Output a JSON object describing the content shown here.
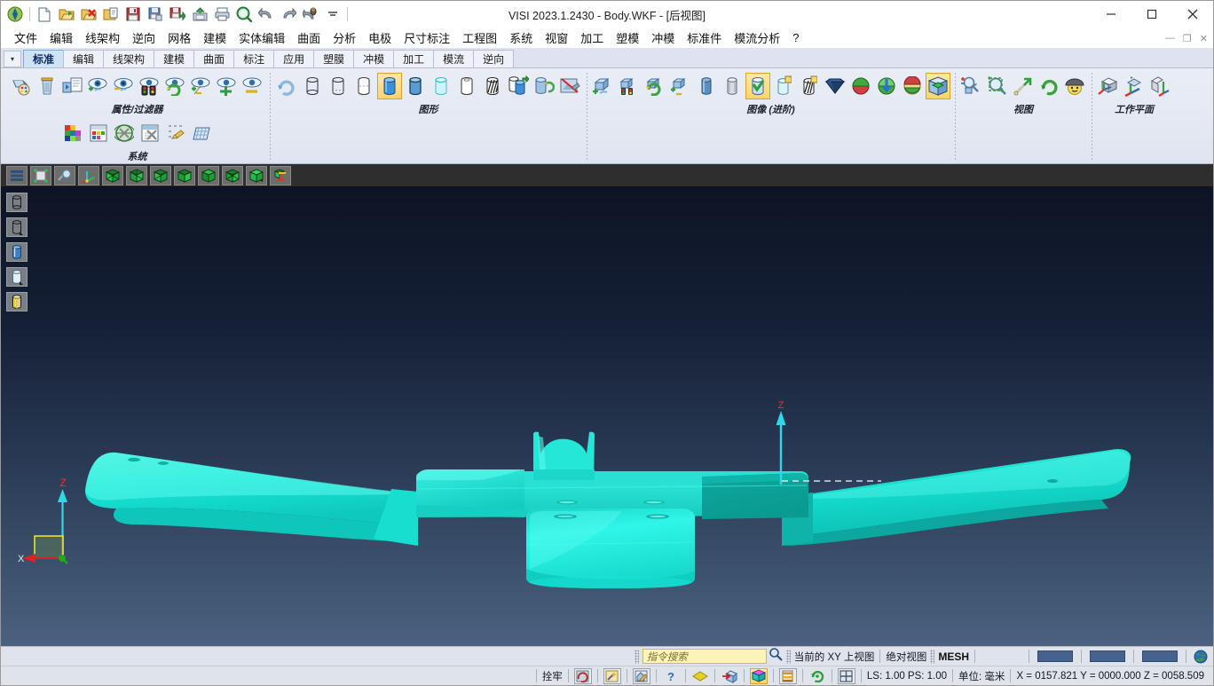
{
  "window": {
    "title": "VISI 2023.1.2430 - Body.WKF - [后视图]",
    "minimize": "—",
    "maximize": "☐",
    "close": "✕"
  },
  "mdi_controls": {
    "minimize": "—",
    "restore": "❐",
    "close": "✕"
  },
  "quick_access": [
    {
      "name": "app-logo-icon",
      "label": "VISI"
    },
    {
      "name": "new-file-icon",
      "label": "新建"
    },
    {
      "name": "open-file-icon",
      "label": "打开"
    },
    {
      "name": "close-file-icon",
      "label": "关闭"
    },
    {
      "name": "open-copy-icon",
      "label": "打开副本"
    },
    {
      "name": "save-icon",
      "label": "保存"
    },
    {
      "name": "save-as-icon",
      "label": "另存为"
    },
    {
      "name": "save-all-icon",
      "label": "全部保存"
    },
    {
      "name": "export-icon",
      "label": "导出"
    },
    {
      "name": "print-icon",
      "label": "打印"
    },
    {
      "name": "print-preview-icon",
      "label": "打印预览"
    },
    {
      "name": "undo-icon",
      "label": "撤销"
    },
    {
      "name": "redo-icon",
      "label": "重做"
    },
    {
      "name": "macro-icon",
      "label": "宏"
    },
    {
      "name": "customize-dropdown-icon",
      "label": "自定义"
    }
  ],
  "menubar": [
    "文件",
    "编辑",
    "线架构",
    "逆向",
    "网格",
    "建模",
    "实体编辑",
    "曲面",
    "分析",
    "电极",
    "尺寸标注",
    "工程图",
    "系统",
    "视窗",
    "加工",
    "塑模",
    "冲模",
    "标准件",
    "模流分析",
    "?"
  ],
  "ribbon_tabs": {
    "dropdown": "▾",
    "items": [
      {
        "label": "标准",
        "active": true
      },
      {
        "label": "编辑",
        "active": false
      },
      {
        "label": "线架构",
        "active": false
      },
      {
        "label": "建模",
        "active": false
      },
      {
        "label": "曲面",
        "active": false
      },
      {
        "label": "标注",
        "active": false
      },
      {
        "label": "应用",
        "active": false
      },
      {
        "label": "塑膜",
        "active": false
      },
      {
        "label": "冲模",
        "active": false
      },
      {
        "label": "加工",
        "active": false
      },
      {
        "label": "模流",
        "active": false
      },
      {
        "label": "逆向",
        "active": false
      }
    ]
  },
  "ribbon_groups": [
    {
      "label": "属性/过滤器",
      "icons": [
        {
          "name": "color-palette-icon",
          "kind": "palette"
        },
        {
          "name": "trash-icon",
          "kind": "trash"
        },
        {
          "name": "layer-copy-icon",
          "kind": "layercopy"
        },
        {
          "name": "eye-add-icon",
          "kind": "eye-add"
        },
        {
          "name": "eye-remove-icon",
          "kind": "eye-minus"
        },
        {
          "name": "eye-traffic-light-icon",
          "kind": "eye-traffic"
        },
        {
          "name": "eye-refresh-icon",
          "kind": "eye-refresh"
        },
        {
          "name": "eye-plusminus-icon",
          "kind": "eye-pm"
        },
        {
          "name": "eye-plus-icon",
          "kind": "eye-plus2"
        },
        {
          "name": "eye-minus-icon",
          "kind": "eye-minus2"
        }
      ]
    },
    {
      "label": "系统",
      "icons": [
        {
          "name": "color-grid-icon",
          "kind": "colorgrid"
        },
        {
          "name": "layer-manager-icon",
          "kind": "layermgr"
        },
        {
          "name": "settings-globe-icon",
          "kind": "settings"
        },
        {
          "name": "config-tools-icon",
          "kind": "configtools"
        },
        {
          "name": "snap-settings-icon",
          "kind": "snapset"
        },
        {
          "name": "grid-plane-icon",
          "kind": "gridplane"
        }
      ]
    },
    {
      "label": "图形",
      "icons": [
        {
          "name": "refresh-view-icon",
          "kind": "refresh"
        },
        {
          "name": "wireframe-icon",
          "kind": "cyl-wire"
        },
        {
          "name": "wireframe-hidden-icon",
          "kind": "cyl-wire2"
        },
        {
          "name": "hidden-line-icon",
          "kind": "cyl-hidden"
        },
        {
          "name": "shaded-icon",
          "kind": "cyl-shade-sel",
          "selected": true
        },
        {
          "name": "shaded-edges-icon",
          "kind": "cyl-shade2"
        },
        {
          "name": "transparent-icon",
          "kind": "cyl-trans"
        },
        {
          "name": "outline-icon",
          "kind": "cyl-outline"
        },
        {
          "name": "hatch-icon",
          "kind": "cyl-hatch"
        },
        {
          "name": "render-icon",
          "kind": "cyl-render"
        },
        {
          "name": "capture-icon",
          "kind": "cyl-capture"
        },
        {
          "name": "image-off-icon",
          "kind": "img-off"
        }
      ]
    },
    {
      "label": "图像 (进阶)",
      "icons": [
        {
          "name": "box-add-icon",
          "kind": "box-add"
        },
        {
          "name": "box-traffic-icon",
          "kind": "box-traffic"
        },
        {
          "name": "box-refresh-icon",
          "kind": "box-refresh"
        },
        {
          "name": "box-plusminus-icon",
          "kind": "box-pm"
        },
        {
          "name": "solid-blue-cyl-icon",
          "kind": "cyl-blue"
        },
        {
          "name": "solid-gray-cyl-icon",
          "kind": "cyl-gray"
        },
        {
          "name": "check-cyl-icon",
          "kind": "cyl-check",
          "selected": true
        },
        {
          "name": "note-cyl-icon",
          "kind": "cyl-note"
        },
        {
          "name": "hatch-note-icon",
          "kind": "cyl-hatchnote"
        },
        {
          "name": "diamond-dark-icon",
          "kind": "diamond"
        },
        {
          "name": "sphere-green-icon",
          "kind": "sphere-green"
        },
        {
          "name": "sphere-arrow-icon",
          "kind": "sphere-arrow"
        },
        {
          "name": "sphere-layers-icon",
          "kind": "sphere-layers"
        },
        {
          "name": "cube-green-icon",
          "kind": "cube-green",
          "selected": true
        }
      ]
    },
    {
      "label": "视图",
      "icons": [
        {
          "name": "zoom-inout-icon",
          "kind": "zoom-pm"
        },
        {
          "name": "zoom-window-icon",
          "kind": "zoom-win"
        },
        {
          "name": "pan-icon",
          "kind": "pan-arrow"
        },
        {
          "name": "rotate-view-icon",
          "kind": "rotate"
        },
        {
          "name": "perspective-icon",
          "kind": "persp"
        }
      ]
    },
    {
      "label": "工作平面",
      "icons": [
        {
          "name": "wcs-define-icon",
          "kind": "wcs1"
        },
        {
          "name": "wcs-align-icon",
          "kind": "wcs2"
        },
        {
          "name": "wcs-move-icon",
          "kind": "wcs3"
        }
      ]
    }
  ],
  "view_toolbar": [
    {
      "name": "layers-list-icon",
      "kind": "vb-lines"
    },
    {
      "name": "fit-view-icon",
      "kind": "vb-fit"
    },
    {
      "name": "zoom-glass-icon",
      "kind": "vb-zoom"
    },
    {
      "name": "axis-view-icon",
      "kind": "vb-axis"
    },
    {
      "name": "view-front-icon",
      "kind": "vb-cube1"
    },
    {
      "name": "view-back-icon",
      "kind": "vb-cube2"
    },
    {
      "name": "view-left-icon",
      "kind": "vb-cube3"
    },
    {
      "name": "view-right-icon",
      "kind": "vb-cube4"
    },
    {
      "name": "view-top-icon",
      "kind": "vb-cube5"
    },
    {
      "name": "view-bottom-icon",
      "kind": "vb-cube6"
    },
    {
      "name": "view-iso-icon",
      "kind": "vb-cube7"
    },
    {
      "name": "view-wcs-icon",
      "kind": "vb-wcs"
    }
  ],
  "left_sidebar": [
    {
      "name": "sidebar-wireframe-icon",
      "kind": "sb-wire"
    },
    {
      "name": "sidebar-hidden-icon",
      "kind": "sb-hidden"
    },
    {
      "name": "sidebar-shaded-icon",
      "kind": "sb-blue"
    },
    {
      "name": "sidebar-transparent-icon",
      "kind": "sb-trans"
    },
    {
      "name": "sidebar-hatch-icon",
      "kind": "sb-hatch"
    }
  ],
  "viewport": {
    "axis_z_label": "Z",
    "axis_x_label": "X",
    "model_axis_z_label": "Z",
    "model_color": "#21e8da",
    "background_top": "#0d1425",
    "background_bottom": "#4a6280"
  },
  "statusbar": {
    "search_placeholder": "指令搜索",
    "search_value": "",
    "search_icon": "search-icon",
    "view_state": "当前的 XY 上视图",
    "absolute_view": "绝对视图",
    "entity_type": "MESH",
    "lock_label": "拴牢",
    "scale": "LS: 1.00 PS: 1.00",
    "units": "单位: 毫米",
    "coordinates": "X = 0157.821 Y = 0000.000 Z = 0058.509",
    "status_icons": [
      {
        "name": "grid-snap-icon",
        "kind": "si-grid"
      },
      {
        "name": "magic-wand-icon",
        "kind": "si-wand"
      },
      {
        "name": "home-snap-icon",
        "kind": "si-home"
      },
      {
        "name": "help-icon",
        "kind": "si-help"
      },
      {
        "name": "diamond-icon",
        "kind": "si-diamond"
      },
      {
        "name": "box-arrow-icon",
        "kind": "si-boxarrow"
      },
      {
        "name": "magenta-cube-icon",
        "kind": "si-cube",
        "highlighted": true
      },
      {
        "name": "layers-stack-icon",
        "kind": "si-stack"
      },
      {
        "name": "rotate-icon",
        "kind": "si-rotate"
      },
      {
        "name": "quad-view-icon",
        "kind": "si-quad"
      }
    ],
    "progress_blocks": 3,
    "globe_icon": "globe-icon"
  }
}
